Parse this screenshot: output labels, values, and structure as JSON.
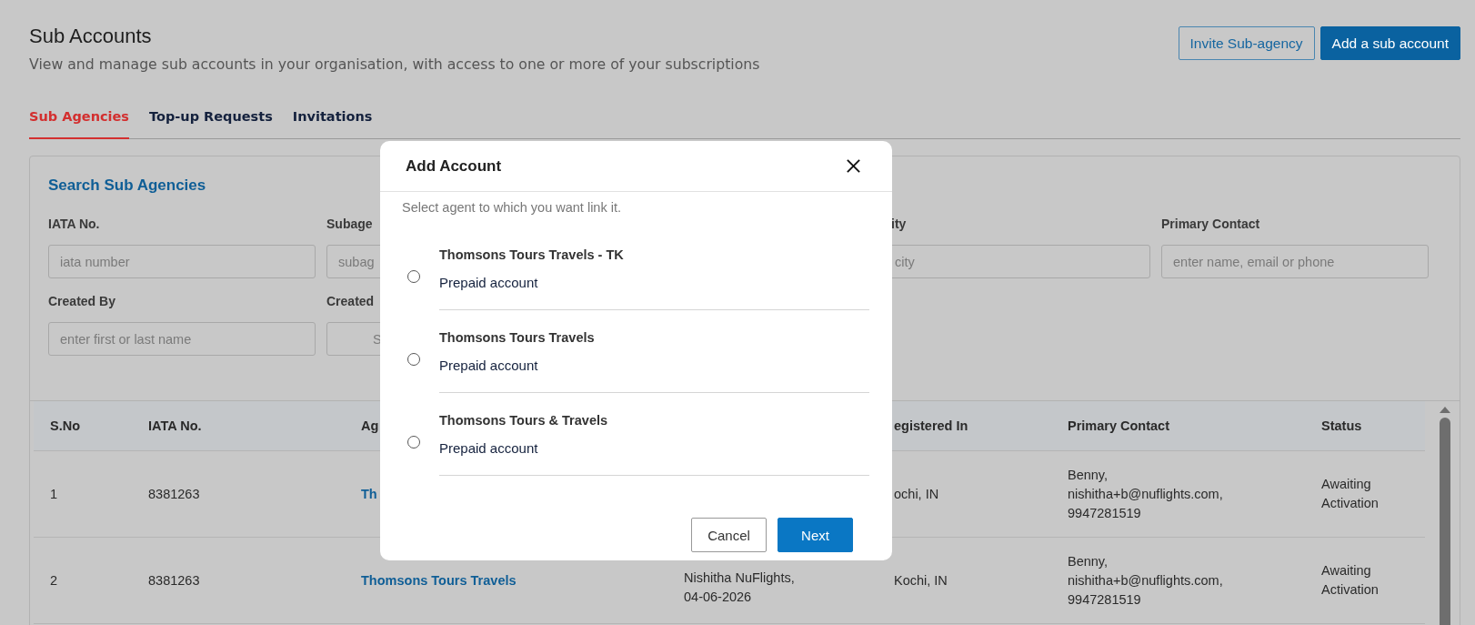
{
  "header": {
    "title": "Sub Accounts",
    "subtitle": "View and manage sub accounts in your organisation, with access to one or more of your subscriptions"
  },
  "actions": [
    {
      "label": "Invite Sub-agency",
      "kind": "outline"
    },
    {
      "label": "Add a sub account",
      "kind": "primary"
    }
  ],
  "tabs": [
    {
      "label": "Sub Agencies",
      "selected": true
    },
    {
      "label": "Top-up Requests",
      "selected": false
    },
    {
      "label": "Invitations",
      "selected": false
    }
  ],
  "search": {
    "title": "Search Sub Agencies",
    "rows": [
      [
        {
          "label": "IATA No.",
          "placeholder": "iata number",
          "kind": "text"
        },
        {
          "label": "Subage",
          "placeholder": "subag",
          "kind": "text"
        },
        {
          "kind": "hidden"
        },
        {
          "label": "ity",
          "placeholder": "city",
          "kind": "text"
        },
        {
          "label": "Primary Contact",
          "placeholder": "enter name, email or phone",
          "kind": "text"
        }
      ],
      [
        {
          "label": "Created By",
          "placeholder": "enter first or last name",
          "kind": "text"
        },
        {
          "label": "Created",
          "placeholder": "S",
          "kind": "date"
        }
      ]
    ]
  },
  "table": {
    "columns": [
      "S.No",
      "IATA No.",
      "Ag",
      "",
      "egistered In",
      "Primary Contact",
      "Status"
    ],
    "rows": [
      {
        "s_no": "1",
        "iata_no": "8381263",
        "agency": "Th",
        "registered_in": "ochi, IN",
        "primary_contact": "Benny,\nnishitha+b@nuflights.com,\n9947281519",
        "status": "Awaiting Activation"
      },
      {
        "s_no": "2",
        "iata_no": "8381263",
        "agency": "Thomsons Tours Travels",
        "created": "Nishitha NuFlights,\n04-06-2026",
        "registered_in": "Kochi, IN",
        "primary_contact": "Benny,\nnishitha+b@nuflights.com,\n9947281519",
        "status": "Awaiting Activation"
      }
    ]
  },
  "modal": {
    "title": "Add Account",
    "subtitle": "Select agent to which you want link it.",
    "options": [
      {
        "name": "Thomsons Tours Travels - TK",
        "type": "Prepaid account",
        "selected": false
      },
      {
        "name": "Thomsons Tours Travels",
        "type": "Prepaid account",
        "selected": false
      },
      {
        "name": "Thomsons Tours & Travels",
        "type": "Prepaid account",
        "selected": false
      }
    ],
    "buttons": [
      {
        "label": "Cancel",
        "kind": "outline"
      },
      {
        "label": "Next",
        "kind": "primary"
      }
    ]
  }
}
